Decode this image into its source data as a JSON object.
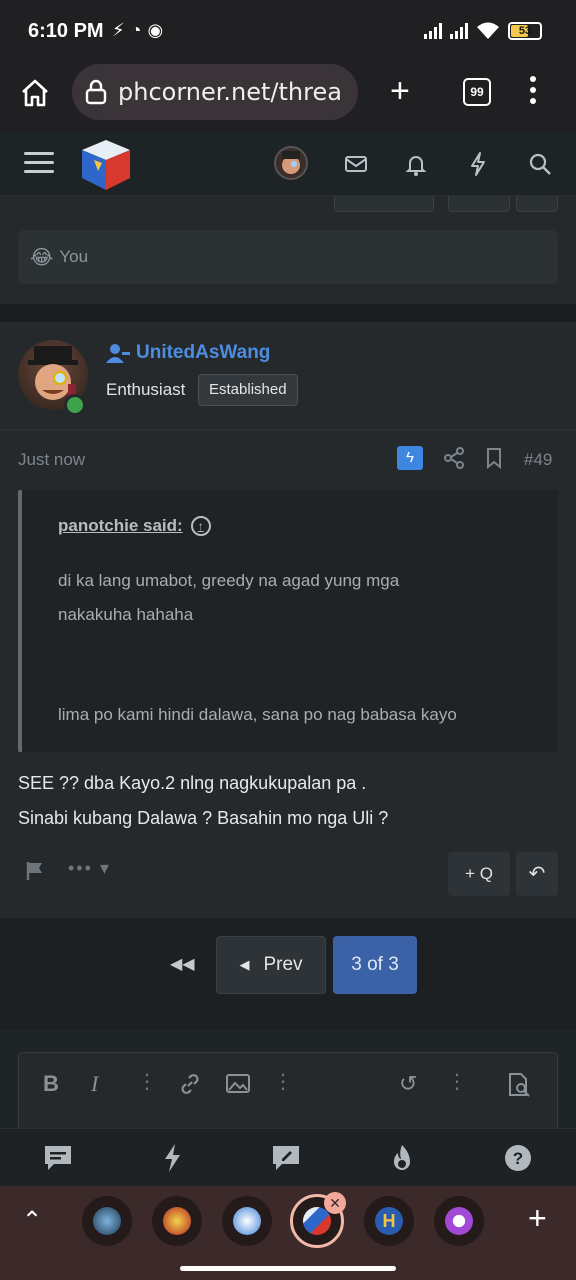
{
  "status_bar": {
    "time": "6:10 PM",
    "battery": "53"
  },
  "browser": {
    "url": "phcorner.net/threa",
    "tab_count": "99"
  },
  "previous_post": {
    "reactions_label": "You"
  },
  "post": {
    "username": "UnitedAsWang",
    "user_title": "Enthusiast",
    "user_badge": "Established",
    "time": "Just now",
    "post_number": "#49",
    "quote": {
      "author": "panotchie said:",
      "line1": "di ka lang umabot, greedy na agad yung mga",
      "line2": "nakakuha hahaha",
      "line3": "lima po kami hindi dalawa, sana po nag babasa kayo"
    },
    "body_line1": "SEE ?? dba Kayo.2 nlng nagkukupalan pa .",
    "body_line2": "Sinabi kubang Dalawa ? Basahin mo nga Uli ?",
    "quote_button": "+ Q"
  },
  "pagination": {
    "prev_label": "Prev",
    "current_page": "3 of 3"
  },
  "colors": {
    "accent_blue": "#4d8de0",
    "page_active": "#3b62a6",
    "online": "#3ea34a",
    "bolt_badge": "#3d87e0"
  }
}
